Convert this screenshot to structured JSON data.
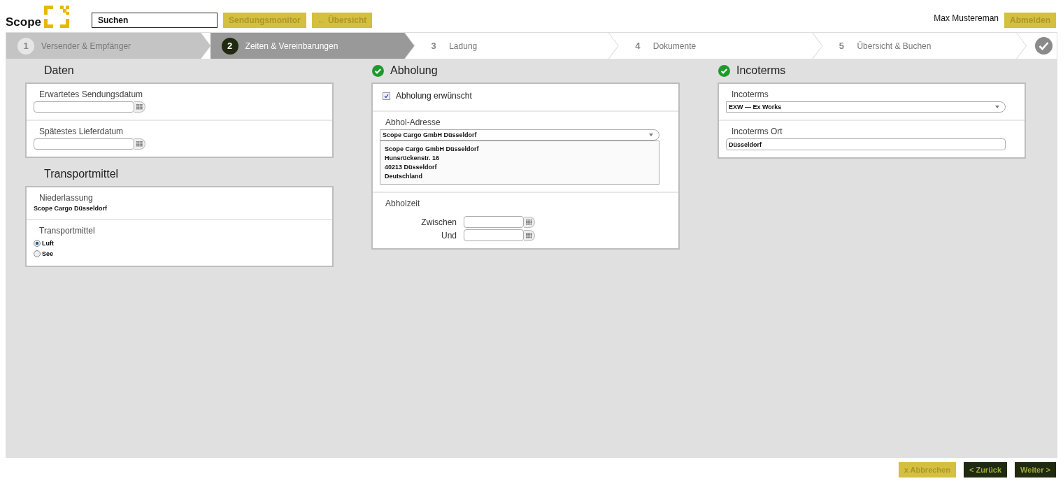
{
  "header": {
    "logo": "Scope",
    "search": {
      "placeholder": "Suchen"
    },
    "nav_buttons": [
      "Sendungsmonitor",
      "← Übersicht"
    ],
    "user": "Max Mustereman",
    "logout": "Abmelden"
  },
  "steps": [
    {
      "number": "1",
      "label": "Versender & Empfänger",
      "selected": false,
      "completed": true
    },
    {
      "number": "2",
      "label": "Zeiten & Vereinbarungen",
      "selected": true,
      "completed": false
    },
    {
      "number": "3",
      "label": "Ladung",
      "selected": false,
      "completed": false
    },
    {
      "number": "4",
      "label": "Dokumente",
      "selected": false,
      "completed": false
    },
    {
      "number": "5",
      "label": "Übersicht & Buchen",
      "selected": false,
      "completed": false
    }
  ],
  "columns": [
    [
      {
        "title": "Daten",
        "valid": false,
        "rows": [
          {
            "kind": "date",
            "label": "Erwartetes Sendungsdatum"
          },
          {
            "kind": "date",
            "label": "Spätestes Lieferdatum"
          }
        ]
      },
      {
        "title": "Transportmittel",
        "valid": false,
        "rows": [
          {
            "kind": "text",
            "label": "Niederlassung",
            "value": "Scope Cargo Düsseldorf"
          },
          {
            "kind": "radio",
            "label": "Transportmittel",
            "options": [
              {
                "label": "Luft",
                "selected": true
              },
              {
                "label": "See",
                "selected": false
              }
            ]
          }
        ]
      }
    ],
    [
      {
        "title": "Abholung",
        "valid": true,
        "rows": [
          {
            "kind": "checkbox",
            "label": "Abholung erwünscht",
            "checked": true
          },
          {
            "kind": "select",
            "label": "Abhol-Adresse",
            "value": "Scope Cargo GmbH Düsseldorf",
            "address": [
              "Scope Cargo GmbH Düsseldorf",
              "Hunsrückenstr. 16",
              "40213 Düsseldorf",
              "Deutschland"
            ]
          },
          {
            "kind": "timerange",
            "label": "Abholzeit",
            "fields": [
              "Zwischen",
              "Und"
            ]
          }
        ]
      }
    ],
    [
      {
        "title": "Incoterms",
        "valid": true,
        "rows": [
          {
            "kind": "select",
            "label": "Incoterms",
            "value": "EXW — Ex Works"
          },
          {
            "kind": "input",
            "label": "Incoterms Ort",
            "value": "Düsseldorf"
          }
        ]
      }
    ]
  ],
  "footer": {
    "cancel": "x Abbrechen",
    "back": "< Zurück",
    "next": "Weiter >"
  }
}
